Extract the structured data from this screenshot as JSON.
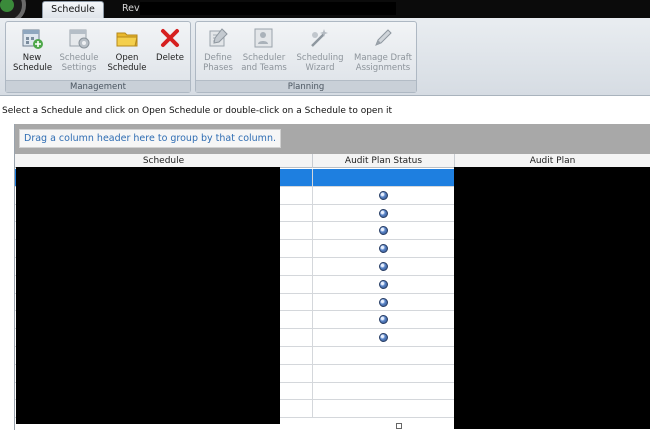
{
  "tabs": [
    {
      "label": "Schedule",
      "active": true
    },
    {
      "label": "Revi",
      "active": false
    }
  ],
  "ribbon": {
    "management": {
      "title": "Management",
      "buttons": [
        {
          "label": "New\nSchedule",
          "icon": "new-schedule-icon",
          "enabled": true
        },
        {
          "label": "Schedule\nSettings",
          "icon": "schedule-settings-icon",
          "enabled": false
        },
        {
          "label": "Open\nSchedule",
          "icon": "folder-icon",
          "enabled": true
        },
        {
          "label": "Delete",
          "icon": "delete-x-icon",
          "enabled": true
        }
      ]
    },
    "planning": {
      "title": "Planning",
      "buttons": [
        {
          "label": "Define\nPhases",
          "icon": "define-phases-icon",
          "enabled": false
        },
        {
          "label": "Scheduler\nand Teams",
          "icon": "scheduler-teams-icon",
          "enabled": false
        },
        {
          "label": "Scheduling\nWizard",
          "icon": "wizard-icon",
          "enabled": false
        },
        {
          "label": "Manage Draft\nAssignments",
          "icon": "pencil-icon",
          "enabled": false
        }
      ]
    }
  },
  "instructions": "Select a Schedule and click on Open Schedule or double-click on a Schedule to open it",
  "grid": {
    "group_hint": "Drag a column header here to group by that column.",
    "columns": [
      "Schedule",
      "Audit Plan Status",
      "Audit Plan"
    ],
    "rows": [
      {
        "selected": true,
        "status_icon": false
      },
      {
        "selected": false,
        "status_icon": true
      },
      {
        "selected": false,
        "status_icon": true
      },
      {
        "selected": false,
        "status_icon": true
      },
      {
        "selected": false,
        "status_icon": true
      },
      {
        "selected": false,
        "status_icon": true
      },
      {
        "selected": false,
        "status_icon": true
      },
      {
        "selected": false,
        "status_icon": true
      },
      {
        "selected": false,
        "status_icon": true
      },
      {
        "selected": false,
        "status_icon": true
      },
      {
        "selected": false,
        "status_icon": false
      },
      {
        "selected": false,
        "status_icon": false
      },
      {
        "selected": false,
        "status_icon": false
      },
      {
        "selected": false,
        "status_icon": false
      }
    ]
  },
  "colors": {
    "selection": "#1e7fe0",
    "group_hint_text": "#2f6db3"
  }
}
